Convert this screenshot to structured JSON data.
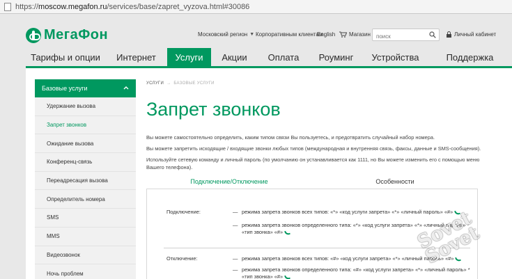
{
  "browser": {
    "url_prefix": "https://",
    "url_host": "moscow.megafon.ru",
    "url_path": "/services/base/zapret_vyzova.html#30086"
  },
  "header": {
    "brand": "МегаФон",
    "region": "Московский регион",
    "corporate": "Корпоративным клиентам",
    "language": "English",
    "shop": "Магазин",
    "search_placeholder": "поиск",
    "account": "Личный кабинет"
  },
  "nav": {
    "items": [
      {
        "label": "Тарифы и опции"
      },
      {
        "label": "Интернет"
      },
      {
        "label": "Услуги"
      },
      {
        "label": "Акции"
      },
      {
        "label": "Оплата"
      },
      {
        "label": "Роуминг"
      },
      {
        "label": "Устройства"
      },
      {
        "label": "Поддержка"
      }
    ],
    "active": "Услуги"
  },
  "sidebar": {
    "heading": "Базовые услуги",
    "items": [
      {
        "label": "Удержание вызова"
      },
      {
        "label": "Запрет звонков"
      },
      {
        "label": "Ожидание вызова"
      },
      {
        "label": "Конференц-связь"
      },
      {
        "label": "Переадресация вызова"
      },
      {
        "label": "Определитель номера"
      },
      {
        "label": "SMS"
      },
      {
        "label": "MMS"
      },
      {
        "label": "Видеозвонок"
      },
      {
        "label": "Ночь проблем"
      }
    ],
    "active": "Запрет звонков"
  },
  "breadcrumb": {
    "parent": "УСЛУГИ",
    "separator": "→",
    "current": "БАЗОВЫЕ УСЛУГИ"
  },
  "main": {
    "title": "Запрет звонков",
    "paragraphs": [
      "Вы можете самостоятельно определить, каким типом связи Вы пользуетесь, и предотвратить случайный набор номера.",
      "Вы можете запретить исходящие / входящие звонки любых типов (международная и внутренняя связь, факсы, данные и SMS-сообщения).",
      "Используйте сетевую команду и личный пароль (по умолчанию он устанавливается как 1111, но Вы можете изменить его с помощью меню Вашего телефона)."
    ],
    "tabs": [
      {
        "label": "Подключение/Отключение"
      },
      {
        "label": "Особенности"
      }
    ],
    "active_tab": "Подключение/Отключение"
  },
  "commands": {
    "connect_label": "Подключение:",
    "connect": [
      "режима запрета звонков всех типов: «*» «код услуги запрета» «*» «личный пароль» «#»",
      "режима запрета звонков определенного типа: «*» «код услуги запрета» «*» «личный пароль» * «тип звонка» «#»"
    ],
    "disconnect_label": "Отключение:",
    "disconnect": [
      "режима запрета звонков всех типов: «#» «код услуги запрета» «*» «личный пароль» «#»",
      "режима запрета звонков определенного типа: «#» «код услуги запрета» «*» «личный пароль» * «тип звонка» «#»"
    ]
  },
  "watermark": {
    "line1": "Sovet",
    "line2": "Sovet"
  },
  "colors": {
    "brand_green": "#00985f"
  }
}
